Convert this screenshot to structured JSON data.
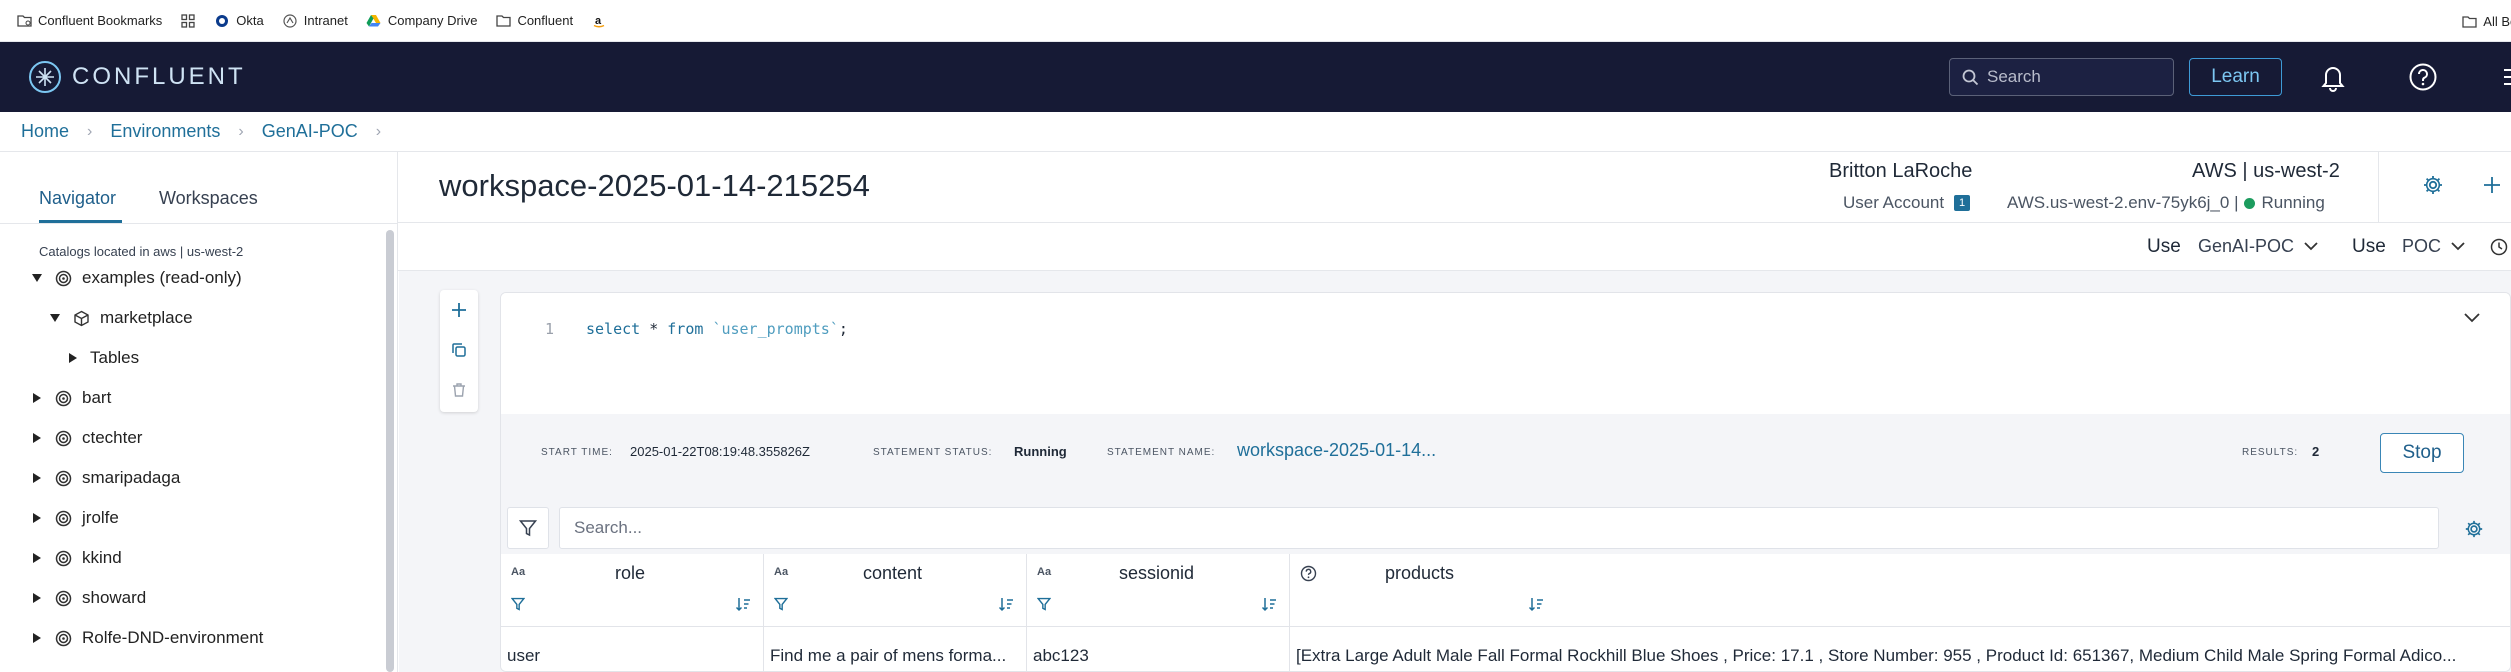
{
  "bookmarks": {
    "items": [
      {
        "label": "Confluent Bookmarks",
        "icon": "folder-icon"
      },
      {
        "label": "",
        "icon": "apps-grid-icon"
      },
      {
        "label": "Okta",
        "icon": "okta-icon"
      },
      {
        "label": "Intranet",
        "icon": "intranet-icon"
      },
      {
        "label": "Company Drive",
        "icon": "drive-icon"
      },
      {
        "label": "Confluent",
        "icon": "folder-icon"
      },
      {
        "label": "",
        "icon": "amazon-icon"
      }
    ],
    "right_label": "All Book"
  },
  "topbar": {
    "brand": "CONFLUENT",
    "search_placeholder": "Search",
    "learn_label": "Learn",
    "icons": [
      "bell-icon",
      "help-icon",
      "menu-icon"
    ]
  },
  "breadcrumb": [
    "Home",
    "Environments",
    "GenAI-POC"
  ],
  "sidebar": {
    "tabs": [
      "Navigator",
      "Workspaces"
    ],
    "active_tab": "Navigator",
    "catalog_note": "Catalogs located in aws | us-west-2",
    "tree": [
      {
        "label": "examples (read-only)",
        "expanded": true,
        "depth": 0,
        "icon": "catalog-icon"
      },
      {
        "label": "marketplace",
        "expanded": true,
        "depth": 1,
        "icon": "database-icon"
      },
      {
        "label": "Tables",
        "expanded": false,
        "depth": 2,
        "icon": ""
      },
      {
        "label": "bart",
        "expanded": false,
        "depth": 0,
        "icon": "catalog-icon"
      },
      {
        "label": "ctechter",
        "expanded": false,
        "depth": 0,
        "icon": "catalog-icon"
      },
      {
        "label": "smaripadaga",
        "expanded": false,
        "depth": 0,
        "icon": "catalog-icon"
      },
      {
        "label": "jrolfe",
        "expanded": false,
        "depth": 0,
        "icon": "catalog-icon"
      },
      {
        "label": "kkind",
        "expanded": false,
        "depth": 0,
        "icon": "catalog-icon"
      },
      {
        "label": "showard",
        "expanded": false,
        "depth": 0,
        "icon": "catalog-icon"
      },
      {
        "label": "Rolfe-DND-environment",
        "expanded": false,
        "depth": 0,
        "icon": "catalog-icon"
      }
    ]
  },
  "workspace": {
    "title": "workspace-2025-01-14-215254",
    "user_name": "Britton LaRoche",
    "user_account": "User Account",
    "user_badge": "1",
    "cloud_region": "AWS | us-west-2",
    "env_id": "AWS.us-west-2.env-75yk6j_0 |",
    "env_status": "Running",
    "use": [
      {
        "label": "Use",
        "value": "GenAI-POC"
      },
      {
        "label": "Use",
        "value": "POC"
      }
    ]
  },
  "editor": {
    "line_number": "1",
    "code": {
      "kw1": "select",
      "star": " * ",
      "kw2": "from",
      "table": "`user_prompts`",
      "end": ";"
    }
  },
  "statement": {
    "start_time_label": "START TIME:",
    "start_time": "2025-01-22T08:19:48.355826Z",
    "status_label": "STATEMENT STATUS:",
    "status": "Running",
    "name_label": "STATEMENT NAME:",
    "name": "workspace-2025-01-14...",
    "results_label": "RESULTS:",
    "results": "2",
    "stop_label": "Stop"
  },
  "results": {
    "search_placeholder": "Search...",
    "columns": [
      {
        "name": "role",
        "type": "Aa"
      },
      {
        "name": "content",
        "type": "Aa"
      },
      {
        "name": "sessionid",
        "type": "Aa"
      },
      {
        "name": "products",
        "type": "?"
      }
    ],
    "rows": [
      [
        "user",
        "Find me a pair of mens forma...",
        "abc123",
        "[Extra Large Adult Male Fall Formal Rockhill Blue Shoes , Price: 17.1 , Store Number: 955 , Product Id: 651367, Medium Child Male Spring Formal Adico..."
      ]
    ]
  }
}
